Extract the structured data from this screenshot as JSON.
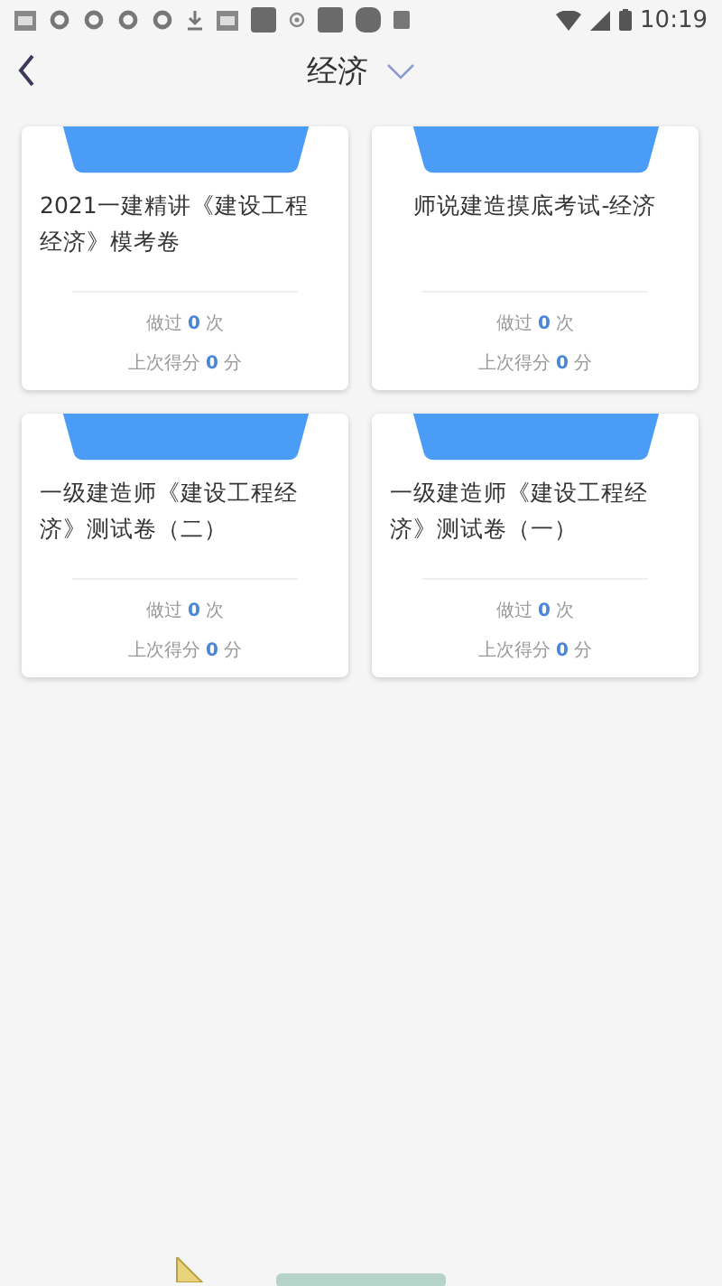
{
  "status_bar": {
    "time": "10:19"
  },
  "header": {
    "title": "经济"
  },
  "papers": [
    {
      "title": "2021一建精讲《建设工程经济》模考卷",
      "done_label": "做过",
      "done_count": "0",
      "done_unit": "次",
      "score_label": "上次得分",
      "score": "0",
      "score_unit": "分"
    },
    {
      "title": "师说建造摸底考试-经济",
      "done_label": "做过",
      "done_count": "0",
      "done_unit": "次",
      "score_label": "上次得分",
      "score": "0",
      "score_unit": "分"
    },
    {
      "title": "一级建造师《建设工程经济》测试卷（二）",
      "done_label": "做过",
      "done_count": "0",
      "done_unit": "次",
      "score_label": "上次得分",
      "score": "0",
      "score_unit": "分"
    },
    {
      "title": "一级建造师《建设工程经济》测试卷（一）",
      "done_label": "做过",
      "done_count": "0",
      "done_unit": "次",
      "score_label": "上次得分",
      "score": "0",
      "score_unit": "分"
    }
  ]
}
